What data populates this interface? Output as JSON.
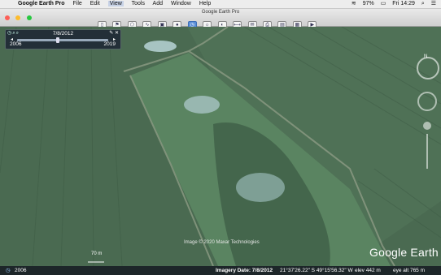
{
  "menubar": {
    "apple": "",
    "app": "Google Earth Pro",
    "menus": [
      "File",
      "Edit",
      "View",
      "Tools",
      "Add",
      "Window",
      "Help"
    ],
    "battery": "97%",
    "clock": "Fri 14:29"
  },
  "window": {
    "title": "Google Earth Pro"
  },
  "timeslider": {
    "date": "7/8/2012",
    "start_year": "2006",
    "end_year": "2019",
    "position_fraction": 0.44
  },
  "map": {
    "copyright": "Image © 2020 Maxar Technologies",
    "scale_label": "70 m",
    "brand": "Google Earth"
  },
  "statusbar": {
    "year": "2006",
    "imagery_date": "Imagery Date: 7/8/2012",
    "coordinates": "21°37'26.22\" S    49°15'56.32\" W",
    "elevation": "elev   442 m",
    "eye_alt": "eye alt   765 m"
  },
  "colors": {
    "field": "#4b6b52",
    "field_light": "#557a5d",
    "pond": "#a7c4c2",
    "toolbar_active": "#5b8fd8"
  }
}
